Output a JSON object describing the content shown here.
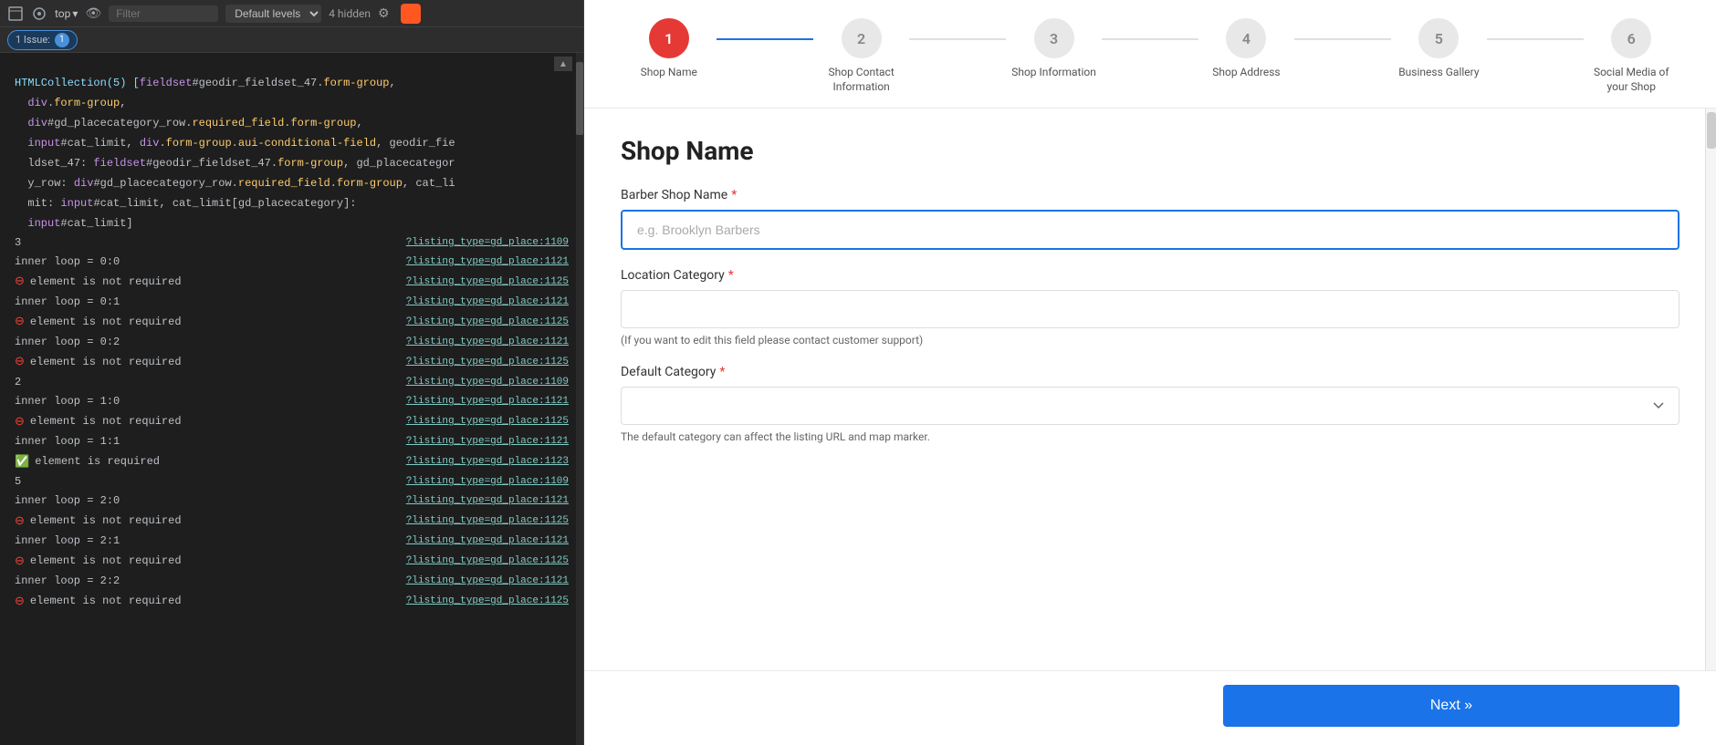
{
  "devtools": {
    "toolbar": {
      "top_label": "top",
      "filter_placeholder": "Filter",
      "levels_label": "Default levels",
      "hidden_count": "4 hidden"
    },
    "issues": {
      "label": "1 Issue:",
      "count": "1"
    },
    "code_block_lines": [
      "HTMLCollection(5) [fieldset#geodir_fieldset_47.form-group,",
      "div.form-group,",
      "div#gd_placecategory_row.required_field.form-group,",
      "input#cat_limit, div.form-group.aui-conditional-field, geodir_fie",
      "ldset_47: fieldset#geodir_fieldset_47.form-group, gd_placecategor",
      "y_row: div#gd_placecategory_row.required_field.form-group, cat_li",
      "mit: input#cat_limit, cat_limit[gd_placecategory]:",
      "input#cat_limit]"
    ],
    "log_lines": [
      {
        "type": "number",
        "label": "3",
        "link": "?listing_type=gd_place:1109"
      },
      {
        "type": "plain",
        "label": "inner loop = 0:0",
        "link": "?listing_type=gd_place:1121"
      },
      {
        "type": "error",
        "label": "element is not required",
        "link": "?listing_type=gd_place:1125"
      },
      {
        "type": "plain",
        "label": "inner loop = 0:1",
        "link": "?listing_type=gd_place:1121"
      },
      {
        "type": "error",
        "label": "element is not required",
        "link": "?listing_type=gd_place:1125"
      },
      {
        "type": "plain",
        "label": "inner loop = 0:2",
        "link": "?listing_type=gd_place:1121"
      },
      {
        "type": "error",
        "label": "element is not required",
        "link": "?listing_type=gd_place:1125"
      },
      {
        "type": "number",
        "label": "2",
        "link": "?listing_type=gd_place:1109"
      },
      {
        "type": "plain",
        "label": "inner loop = 1:0",
        "link": "?listing_type=gd_place:1121"
      },
      {
        "type": "error",
        "label": "element is not required",
        "link": "?listing_type=gd_place:1125"
      },
      {
        "type": "plain",
        "label": "inner loop = 1:1",
        "link": "?listing_type=gd_place:1121"
      },
      {
        "type": "success",
        "label": "element is required",
        "link": "?listing_type=gd_place:1123"
      },
      {
        "type": "number",
        "label": "5",
        "link": "?listing_type=gd_place:1109"
      },
      {
        "type": "plain",
        "label": "inner loop = 2:0",
        "link": "?listing_type=gd_place:1121"
      },
      {
        "type": "error",
        "label": "element is not required",
        "link": "?listing_type=gd_place:1125"
      },
      {
        "type": "plain",
        "label": "inner loop = 2:1",
        "link": "?listing_type=gd_place:1121"
      },
      {
        "type": "error",
        "label": "element is not required",
        "link": "?listing_type=gd_place:1125"
      },
      {
        "type": "plain",
        "label": "inner loop = 2:2",
        "link": "?listing_type=gd_place:1121"
      },
      {
        "type": "error",
        "label": "element is not required",
        "link": "?listing_type=gd_place:1125"
      }
    ]
  },
  "stepper": {
    "steps": [
      {
        "number": "1",
        "label": "Shop Name",
        "active": true
      },
      {
        "number": "2",
        "label": "Shop Contact Information",
        "active": false
      },
      {
        "number": "3",
        "label": "Shop Information",
        "active": false
      },
      {
        "number": "4",
        "label": "Shop Address",
        "active": false
      },
      {
        "number": "5",
        "label": "Business Gallery",
        "active": false
      },
      {
        "number": "6",
        "label": "Social Media of your Shop",
        "active": false
      }
    ]
  },
  "form": {
    "title": "Shop Name",
    "fields": {
      "shop_name": {
        "label": "Barber Shop Name",
        "placeholder": "e.g. Brooklyn Barbers",
        "required": true,
        "value": ""
      },
      "location_category": {
        "label": "Location Category",
        "required": true,
        "hint": "(If you want to edit this field please contact customer support)",
        "value": ""
      },
      "default_category": {
        "label": "Default Category",
        "required": true,
        "hint": "The default category can affect the listing URL and map marker.",
        "value": ""
      }
    },
    "next_button": "Next »"
  },
  "colors": {
    "active_step": "#e53935",
    "inactive_step": "#e0e0e0",
    "active_connector": "#1a73e8",
    "button_bg": "#1a73e8",
    "input_border_active": "#1a73e8"
  }
}
